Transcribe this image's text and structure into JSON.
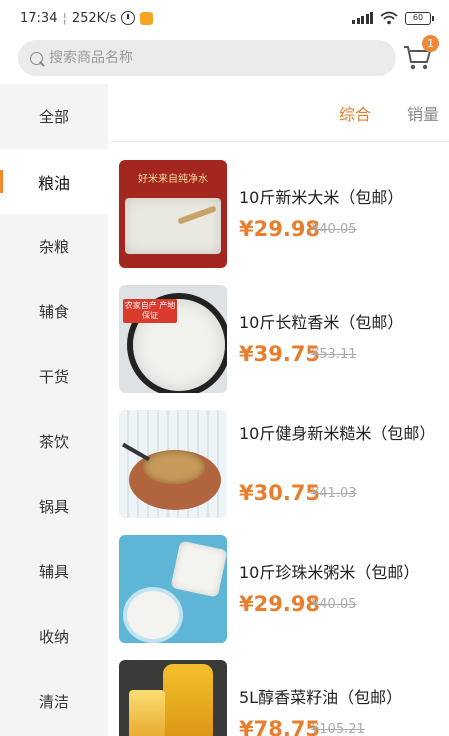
{
  "status_bar": {
    "time": "17:34",
    "speed": "252K/s",
    "battery": "60"
  },
  "search": {
    "placeholder": "搜索商品名称"
  },
  "cart": {
    "badge": "1"
  },
  "sidebar": {
    "items": [
      {
        "label": "全部"
      },
      {
        "label": "粮油"
      },
      {
        "label": "杂粮"
      },
      {
        "label": "辅食"
      },
      {
        "label": "干货"
      },
      {
        "label": "茶饮"
      },
      {
        "label": "锅具"
      },
      {
        "label": "辅具"
      },
      {
        "label": "收纳"
      },
      {
        "label": "清洁"
      }
    ],
    "active_index": 1
  },
  "sort_tabs": [
    {
      "label": "综合"
    },
    {
      "label": "销量"
    }
  ],
  "products": [
    {
      "name": "10斤新米大米（包邮）",
      "price": "¥29.98",
      "old_price": "¥40.05",
      "image_text": "好米来自纯净水"
    },
    {
      "name": "10斤长粒香米（包邮）",
      "price": "¥39.75",
      "old_price": "¥53.11",
      "image_text": "农家自产 产地保证"
    },
    {
      "name": "10斤健身新米糙米（包邮）",
      "price": "¥30.75",
      "old_price": "¥41.03"
    },
    {
      "name": "10斤珍珠米粥米（包邮）",
      "price": "¥29.98",
      "old_price": "¥40.05"
    },
    {
      "name": "5L醇香菜籽油（包邮）",
      "price": "¥78.75",
      "old_price": "¥105.21"
    }
  ],
  "colors": {
    "accent": "#e87e2c",
    "sidebar_bg": "#f4f4f4",
    "search_bg": "#ebebeb"
  }
}
